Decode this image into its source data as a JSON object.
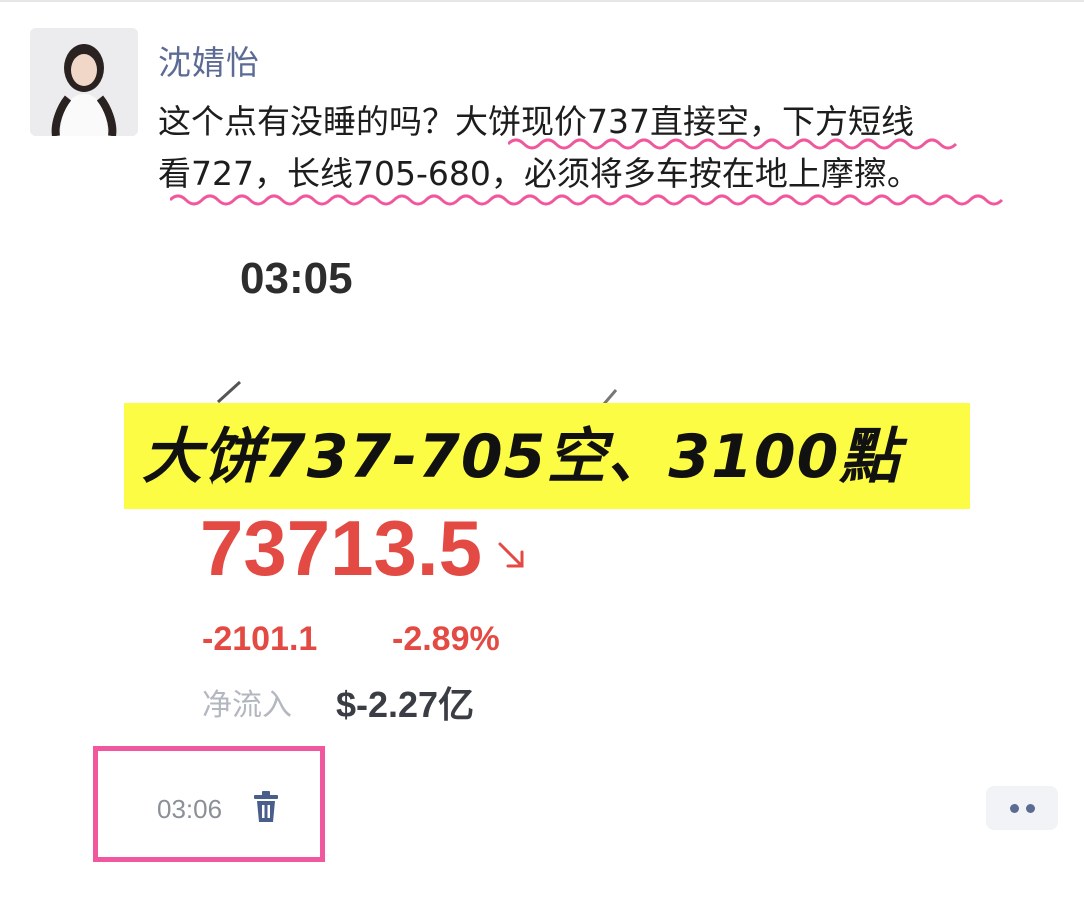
{
  "post": {
    "username": "沈婧怡",
    "text_line1": "这个点有没睡的吗？大饼现价737直接空，下方短线",
    "text_line2": "看727，长线705-680，必须将多车按在地上摩擦。"
  },
  "image": {
    "time": "03:05",
    "banner": "大饼737-705空、3100點",
    "price": "73713.5",
    "change_abs": "-2101.1",
    "change_pct": "-2.89%",
    "flow_label": "净流入",
    "flow_value": "$-2.27亿",
    "colors": {
      "banner_bg": "#fbfc43",
      "price_red": "#e44a44",
      "highlight_pink": "#f0579c"
    }
  },
  "footer": {
    "time": "03:06",
    "delete_icon": "trash-icon",
    "more_icon": "more-dots-icon"
  }
}
